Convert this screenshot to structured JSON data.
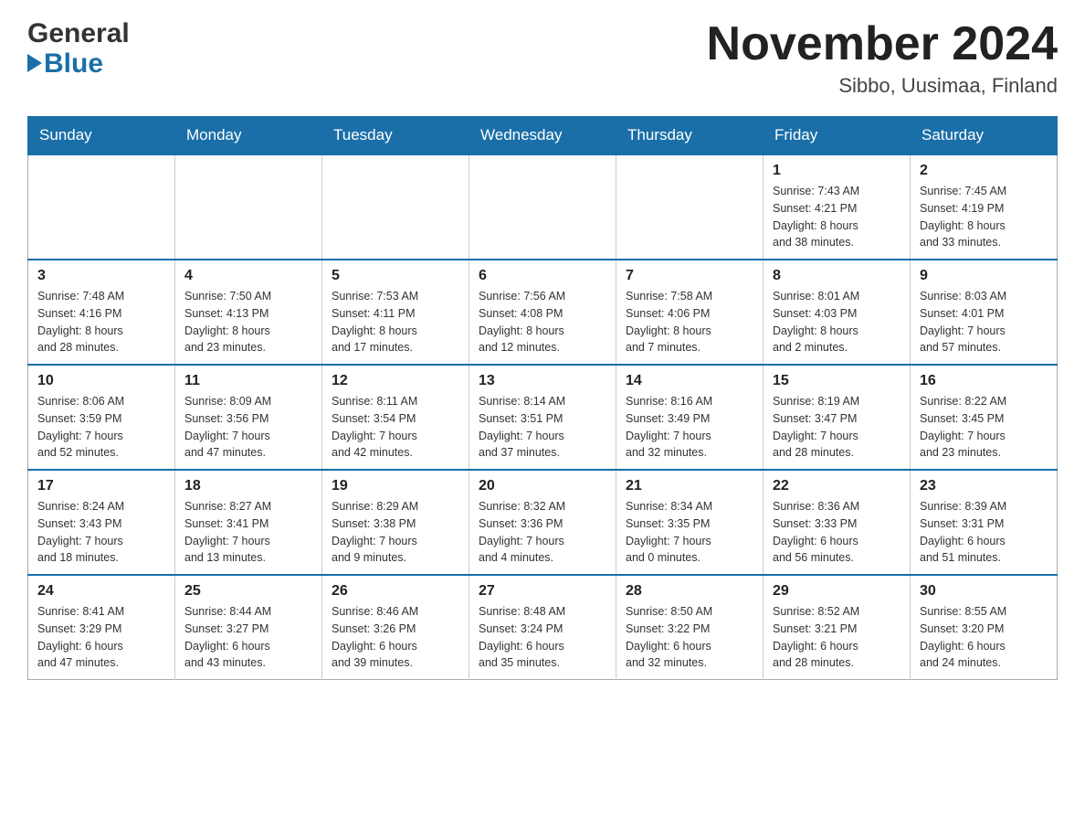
{
  "header": {
    "logo_line1": "General",
    "logo_line2": "Blue",
    "month_title": "November 2024",
    "location": "Sibbo, Uusimaa, Finland"
  },
  "weekdays": [
    "Sunday",
    "Monday",
    "Tuesday",
    "Wednesday",
    "Thursday",
    "Friday",
    "Saturday"
  ],
  "weeks": [
    [
      {
        "day": "",
        "info": ""
      },
      {
        "day": "",
        "info": ""
      },
      {
        "day": "",
        "info": ""
      },
      {
        "day": "",
        "info": ""
      },
      {
        "day": "",
        "info": ""
      },
      {
        "day": "1",
        "info": "Sunrise: 7:43 AM\nSunset: 4:21 PM\nDaylight: 8 hours\nand 38 minutes."
      },
      {
        "day": "2",
        "info": "Sunrise: 7:45 AM\nSunset: 4:19 PM\nDaylight: 8 hours\nand 33 minutes."
      }
    ],
    [
      {
        "day": "3",
        "info": "Sunrise: 7:48 AM\nSunset: 4:16 PM\nDaylight: 8 hours\nand 28 minutes."
      },
      {
        "day": "4",
        "info": "Sunrise: 7:50 AM\nSunset: 4:13 PM\nDaylight: 8 hours\nand 23 minutes."
      },
      {
        "day": "5",
        "info": "Sunrise: 7:53 AM\nSunset: 4:11 PM\nDaylight: 8 hours\nand 17 minutes."
      },
      {
        "day": "6",
        "info": "Sunrise: 7:56 AM\nSunset: 4:08 PM\nDaylight: 8 hours\nand 12 minutes."
      },
      {
        "day": "7",
        "info": "Sunrise: 7:58 AM\nSunset: 4:06 PM\nDaylight: 8 hours\nand 7 minutes."
      },
      {
        "day": "8",
        "info": "Sunrise: 8:01 AM\nSunset: 4:03 PM\nDaylight: 8 hours\nand 2 minutes."
      },
      {
        "day": "9",
        "info": "Sunrise: 8:03 AM\nSunset: 4:01 PM\nDaylight: 7 hours\nand 57 minutes."
      }
    ],
    [
      {
        "day": "10",
        "info": "Sunrise: 8:06 AM\nSunset: 3:59 PM\nDaylight: 7 hours\nand 52 minutes."
      },
      {
        "day": "11",
        "info": "Sunrise: 8:09 AM\nSunset: 3:56 PM\nDaylight: 7 hours\nand 47 minutes."
      },
      {
        "day": "12",
        "info": "Sunrise: 8:11 AM\nSunset: 3:54 PM\nDaylight: 7 hours\nand 42 minutes."
      },
      {
        "day": "13",
        "info": "Sunrise: 8:14 AM\nSunset: 3:51 PM\nDaylight: 7 hours\nand 37 minutes."
      },
      {
        "day": "14",
        "info": "Sunrise: 8:16 AM\nSunset: 3:49 PM\nDaylight: 7 hours\nand 32 minutes."
      },
      {
        "day": "15",
        "info": "Sunrise: 8:19 AM\nSunset: 3:47 PM\nDaylight: 7 hours\nand 28 minutes."
      },
      {
        "day": "16",
        "info": "Sunrise: 8:22 AM\nSunset: 3:45 PM\nDaylight: 7 hours\nand 23 minutes."
      }
    ],
    [
      {
        "day": "17",
        "info": "Sunrise: 8:24 AM\nSunset: 3:43 PM\nDaylight: 7 hours\nand 18 minutes."
      },
      {
        "day": "18",
        "info": "Sunrise: 8:27 AM\nSunset: 3:41 PM\nDaylight: 7 hours\nand 13 minutes."
      },
      {
        "day": "19",
        "info": "Sunrise: 8:29 AM\nSunset: 3:38 PM\nDaylight: 7 hours\nand 9 minutes."
      },
      {
        "day": "20",
        "info": "Sunrise: 8:32 AM\nSunset: 3:36 PM\nDaylight: 7 hours\nand 4 minutes."
      },
      {
        "day": "21",
        "info": "Sunrise: 8:34 AM\nSunset: 3:35 PM\nDaylight: 7 hours\nand 0 minutes."
      },
      {
        "day": "22",
        "info": "Sunrise: 8:36 AM\nSunset: 3:33 PM\nDaylight: 6 hours\nand 56 minutes."
      },
      {
        "day": "23",
        "info": "Sunrise: 8:39 AM\nSunset: 3:31 PM\nDaylight: 6 hours\nand 51 minutes."
      }
    ],
    [
      {
        "day": "24",
        "info": "Sunrise: 8:41 AM\nSunset: 3:29 PM\nDaylight: 6 hours\nand 47 minutes."
      },
      {
        "day": "25",
        "info": "Sunrise: 8:44 AM\nSunset: 3:27 PM\nDaylight: 6 hours\nand 43 minutes."
      },
      {
        "day": "26",
        "info": "Sunrise: 8:46 AM\nSunset: 3:26 PM\nDaylight: 6 hours\nand 39 minutes."
      },
      {
        "day": "27",
        "info": "Sunrise: 8:48 AM\nSunset: 3:24 PM\nDaylight: 6 hours\nand 35 minutes."
      },
      {
        "day": "28",
        "info": "Sunrise: 8:50 AM\nSunset: 3:22 PM\nDaylight: 6 hours\nand 32 minutes."
      },
      {
        "day": "29",
        "info": "Sunrise: 8:52 AM\nSunset: 3:21 PM\nDaylight: 6 hours\nand 28 minutes."
      },
      {
        "day": "30",
        "info": "Sunrise: 8:55 AM\nSunset: 3:20 PM\nDaylight: 6 hours\nand 24 minutes."
      }
    ]
  ]
}
